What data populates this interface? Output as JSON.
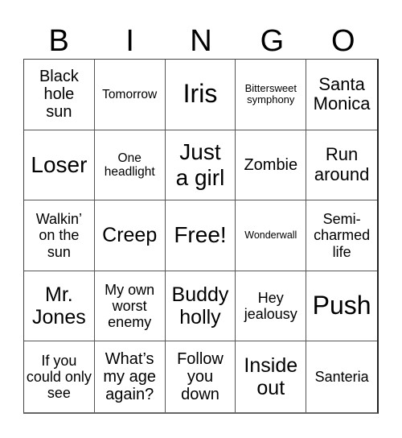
{
  "header": {
    "letters": [
      "B",
      "I",
      "N",
      "G",
      "O"
    ]
  },
  "cells": [
    "Black hole sun",
    "Tomorrow",
    "Iris",
    "Bittersweet symphony",
    "Santa Monica",
    "Loser",
    "One headlight",
    "Just a girl",
    "Zombie",
    "Run around",
    "Walkin’ on the sun",
    "Creep",
    "Free!",
    "Wonderwall",
    "Semi-charmed life",
    "Mr. Jones",
    "My own worst enemy",
    "Buddy holly",
    "Hey jealousy",
    "Push",
    "If you could only see",
    "What’s my age again?",
    "Follow you down",
    "Inside out",
    "Santeria"
  ]
}
